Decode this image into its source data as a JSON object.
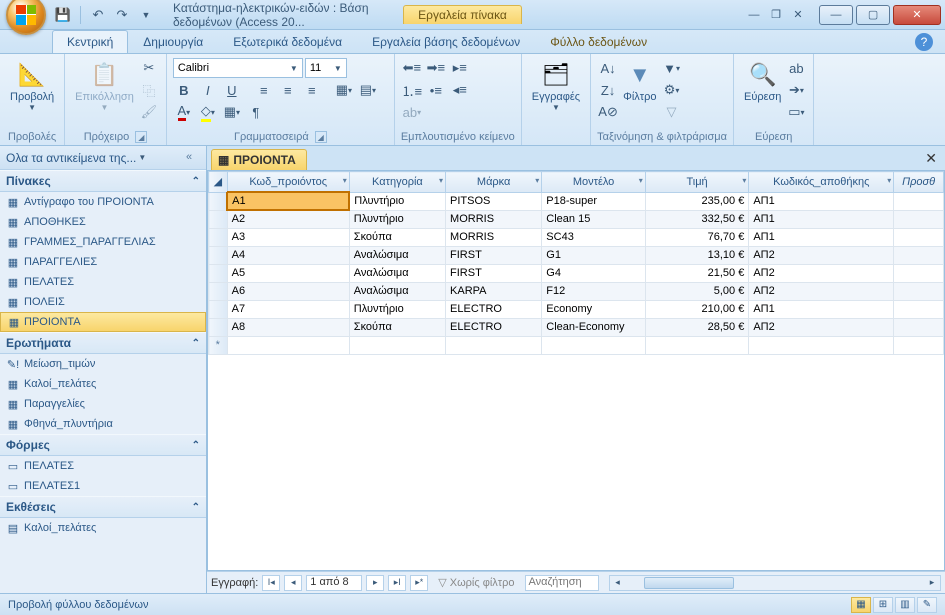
{
  "title": "Κατάστημα-ηλεκτρικών-ειδών : Βάση δεδομένων (Access 20...",
  "contextual_tab": "Εργαλεία πίνακα",
  "tabs": {
    "home": "Κεντρική",
    "create": "Δημιουργία",
    "external": "Εξωτερικά δεδομένα",
    "dbtools": "Εργαλεία βάσης δεδομένων",
    "datasheet": "Φύλλο δεδομένων"
  },
  "ribbon": {
    "view": "Προβολή",
    "paste": "Επικόλληση",
    "views": "Προβολές",
    "clipboard": "Πρόχειρο",
    "font_name": "Calibri",
    "font_size": "11",
    "font_group": "Γραμματοσειρά",
    "richtext_group": "Εμπλουτισμένο κείμενο",
    "records": "Εγγραφές",
    "filter": "Φίλτρο",
    "sortfilter_group": "Ταξινόμηση & φιλτράρισμα",
    "find": "Εύρεση",
    "find_group": "Εύρεση"
  },
  "nav": {
    "header": "Ολα τα αντικείμενα της...",
    "sections": {
      "tables": "Πίνακες",
      "queries": "Ερωτήματα",
      "forms": "Φόρμες",
      "reports": "Εκθέσεις"
    },
    "tables": [
      "Αντίγραφο του ΠΡΟΙΟΝΤΑ",
      "ΑΠΟΘΗΚΕΣ",
      "ΓΡΑΜΜΕΣ_ΠΑΡΑΓΓΕΛΙΑΣ",
      "ΠΑΡΑΓΓΕΛΙΕΣ",
      "ΠΕΛΑΤΕΣ",
      "ΠΟΛΕΙΣ",
      "ΠΡΟΙΟΝΤΑ"
    ],
    "queries": [
      "Μείωση_τιμών",
      "Καλοί_πελάτες",
      "Παραγγελίες",
      "Φθηνά_πλυντήρια"
    ],
    "forms": [
      "ΠΕΛΑΤΕΣ",
      "ΠΕΛΑΤΕΣ1"
    ],
    "reports": [
      "Καλοί_πελάτες"
    ]
  },
  "datasheet": {
    "tab": "ΠΡΟΙΟΝΤΑ",
    "columns": [
      "Κωδ_προιόντος",
      "Κατηγορία",
      "Μάρκα",
      "Μοντέλο",
      "Τιμή",
      "Κωδικός_αποθήκης",
      "Προσθ"
    ],
    "rows": [
      {
        "kwd": "A1",
        "kat": "Πλυντήριο",
        "mar": "PITSOS",
        "mod": "P18-super",
        "tim": "235,00 €",
        "apo": "ΑΠ1"
      },
      {
        "kwd": "A2",
        "kat": "Πλυντήριο",
        "mar": "MORRIS",
        "mod": "Clean 15",
        "tim": "332,50 €",
        "apo": "ΑΠ1"
      },
      {
        "kwd": "A3",
        "kat": "Σκούπα",
        "mar": "MORRIS",
        "mod": "SC43",
        "tim": "76,70 €",
        "apo": "ΑΠ1"
      },
      {
        "kwd": "A4",
        "kat": "Αναλώσιμα",
        "mar": "FIRST",
        "mod": "G1",
        "tim": "13,10 €",
        "apo": "ΑΠ2"
      },
      {
        "kwd": "A5",
        "kat": "Αναλώσιμα",
        "mar": "FIRST",
        "mod": "G4",
        "tim": "21,50 €",
        "apo": "ΑΠ2"
      },
      {
        "kwd": "A6",
        "kat": "Αναλώσιμα",
        "mar": "KARPA",
        "mod": "F12",
        "tim": "5,00 €",
        "apo": "ΑΠ2"
      },
      {
        "kwd": "A7",
        "kat": "Πλυντήριο",
        "mar": "ELECTRO",
        "mod": "Economy",
        "tim": "210,00 €",
        "apo": "ΑΠ1"
      },
      {
        "kwd": "A8",
        "kat": "Σκούπα",
        "mar": "ELECTRO",
        "mod": "Clean-Economy",
        "tim": "28,50 €",
        "apo": "ΑΠ2"
      }
    ]
  },
  "recordnav": {
    "label": "Εγγραφή:",
    "position": "1 από 8",
    "nofilter": "Χωρίς φίλτρο",
    "search": "Αναζήτηση"
  },
  "status": "Προβολή φύλλου δεδομένων"
}
